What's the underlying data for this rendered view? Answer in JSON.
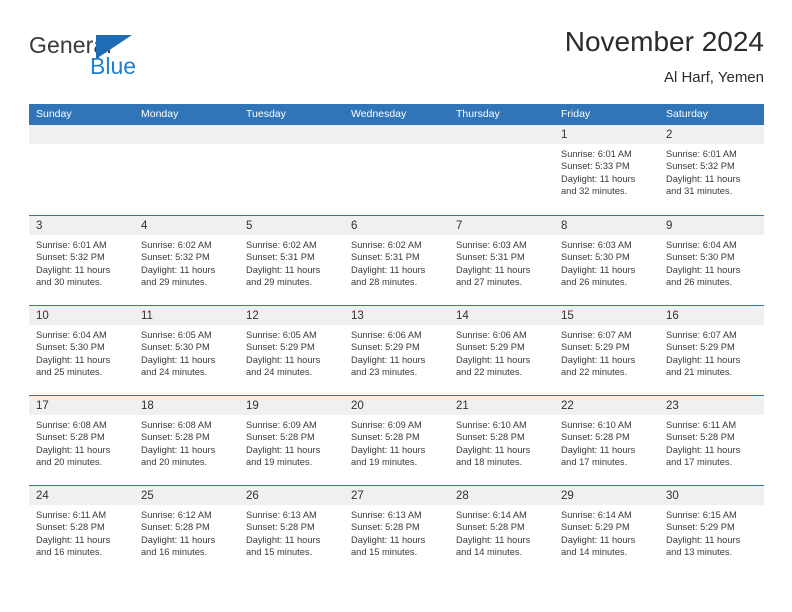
{
  "brand": {
    "name_primary": "General",
    "name_secondary": "Blue",
    "flag_icon": "triangle-flag-icon",
    "color_primary": "#3a3a3a",
    "color_secondary": "#1f7fd4"
  },
  "header": {
    "title": "November 2024",
    "subtitle": "Al Harf, Yemen"
  },
  "theme": {
    "header_blue": "#3075b8",
    "day_band_gray": "#f0f0f0",
    "text_dark": "#2b2b2b"
  },
  "weekdays": [
    "Sunday",
    "Monday",
    "Tuesday",
    "Wednesday",
    "Thursday",
    "Friday",
    "Saturday"
  ],
  "weeks": [
    [
      {
        "day": "",
        "empty": true
      },
      {
        "day": "",
        "empty": true
      },
      {
        "day": "",
        "empty": true
      },
      {
        "day": "",
        "empty": true
      },
      {
        "day": "",
        "empty": true
      },
      {
        "day": "1",
        "sunrise": "Sunrise: 6:01 AM",
        "sunset": "Sunset: 5:33 PM",
        "daylight": "Daylight: 11 hours and 32 minutes."
      },
      {
        "day": "2",
        "sunrise": "Sunrise: 6:01 AM",
        "sunset": "Sunset: 5:32 PM",
        "daylight": "Daylight: 11 hours and 31 minutes."
      }
    ],
    [
      {
        "day": "3",
        "sunrise": "Sunrise: 6:01 AM",
        "sunset": "Sunset: 5:32 PM",
        "daylight": "Daylight: 11 hours and 30 minutes."
      },
      {
        "day": "4",
        "sunrise": "Sunrise: 6:02 AM",
        "sunset": "Sunset: 5:32 PM",
        "daylight": "Daylight: 11 hours and 29 minutes."
      },
      {
        "day": "5",
        "sunrise": "Sunrise: 6:02 AM",
        "sunset": "Sunset: 5:31 PM",
        "daylight": "Daylight: 11 hours and 29 minutes."
      },
      {
        "day": "6",
        "sunrise": "Sunrise: 6:02 AM",
        "sunset": "Sunset: 5:31 PM",
        "daylight": "Daylight: 11 hours and 28 minutes."
      },
      {
        "day": "7",
        "sunrise": "Sunrise: 6:03 AM",
        "sunset": "Sunset: 5:31 PM",
        "daylight": "Daylight: 11 hours and 27 minutes."
      },
      {
        "day": "8",
        "sunrise": "Sunrise: 6:03 AM",
        "sunset": "Sunset: 5:30 PM",
        "daylight": "Daylight: 11 hours and 26 minutes."
      },
      {
        "day": "9",
        "sunrise": "Sunrise: 6:04 AM",
        "sunset": "Sunset: 5:30 PM",
        "daylight": "Daylight: 11 hours and 26 minutes."
      }
    ],
    [
      {
        "day": "10",
        "sunrise": "Sunrise: 6:04 AM",
        "sunset": "Sunset: 5:30 PM",
        "daylight": "Daylight: 11 hours and 25 minutes."
      },
      {
        "day": "11",
        "sunrise": "Sunrise: 6:05 AM",
        "sunset": "Sunset: 5:30 PM",
        "daylight": "Daylight: 11 hours and 24 minutes."
      },
      {
        "day": "12",
        "sunrise": "Sunrise: 6:05 AM",
        "sunset": "Sunset: 5:29 PM",
        "daylight": "Daylight: 11 hours and 24 minutes."
      },
      {
        "day": "13",
        "sunrise": "Sunrise: 6:06 AM",
        "sunset": "Sunset: 5:29 PM",
        "daylight": "Daylight: 11 hours and 23 minutes."
      },
      {
        "day": "14",
        "sunrise": "Sunrise: 6:06 AM",
        "sunset": "Sunset: 5:29 PM",
        "daylight": "Daylight: 11 hours and 22 minutes."
      },
      {
        "day": "15",
        "sunrise": "Sunrise: 6:07 AM",
        "sunset": "Sunset: 5:29 PM",
        "daylight": "Daylight: 11 hours and 22 minutes."
      },
      {
        "day": "16",
        "sunrise": "Sunrise: 6:07 AM",
        "sunset": "Sunset: 5:29 PM",
        "daylight": "Daylight: 11 hours and 21 minutes."
      }
    ],
    [
      {
        "day": "17",
        "sunrise": "Sunrise: 6:08 AM",
        "sunset": "Sunset: 5:28 PM",
        "daylight": "Daylight: 11 hours and 20 minutes."
      },
      {
        "day": "18",
        "sunrise": "Sunrise: 6:08 AM",
        "sunset": "Sunset: 5:28 PM",
        "daylight": "Daylight: 11 hours and 20 minutes."
      },
      {
        "day": "19",
        "sunrise": "Sunrise: 6:09 AM",
        "sunset": "Sunset: 5:28 PM",
        "daylight": "Daylight: 11 hours and 19 minutes."
      },
      {
        "day": "20",
        "sunrise": "Sunrise: 6:09 AM",
        "sunset": "Sunset: 5:28 PM",
        "daylight": "Daylight: 11 hours and 19 minutes."
      },
      {
        "day": "21",
        "sunrise": "Sunrise: 6:10 AM",
        "sunset": "Sunset: 5:28 PM",
        "daylight": "Daylight: 11 hours and 18 minutes."
      },
      {
        "day": "22",
        "sunrise": "Sunrise: 6:10 AM",
        "sunset": "Sunset: 5:28 PM",
        "daylight": "Daylight: 11 hours and 17 minutes."
      },
      {
        "day": "23",
        "sunrise": "Sunrise: 6:11 AM",
        "sunset": "Sunset: 5:28 PM",
        "daylight": "Daylight: 11 hours and 17 minutes."
      }
    ],
    [
      {
        "day": "24",
        "sunrise": "Sunrise: 6:11 AM",
        "sunset": "Sunset: 5:28 PM",
        "daylight": "Daylight: 11 hours and 16 minutes."
      },
      {
        "day": "25",
        "sunrise": "Sunrise: 6:12 AM",
        "sunset": "Sunset: 5:28 PM",
        "daylight": "Daylight: 11 hours and 16 minutes."
      },
      {
        "day": "26",
        "sunrise": "Sunrise: 6:13 AM",
        "sunset": "Sunset: 5:28 PM",
        "daylight": "Daylight: 11 hours and 15 minutes."
      },
      {
        "day": "27",
        "sunrise": "Sunrise: 6:13 AM",
        "sunset": "Sunset: 5:28 PM",
        "daylight": "Daylight: 11 hours and 15 minutes."
      },
      {
        "day": "28",
        "sunrise": "Sunrise: 6:14 AM",
        "sunset": "Sunset: 5:28 PM",
        "daylight": "Daylight: 11 hours and 14 minutes."
      },
      {
        "day": "29",
        "sunrise": "Sunrise: 6:14 AM",
        "sunset": "Sunset: 5:29 PM",
        "daylight": "Daylight: 11 hours and 14 minutes."
      },
      {
        "day": "30",
        "sunrise": "Sunrise: 6:15 AM",
        "sunset": "Sunset: 5:29 PM",
        "daylight": "Daylight: 11 hours and 13 minutes."
      }
    ]
  ]
}
